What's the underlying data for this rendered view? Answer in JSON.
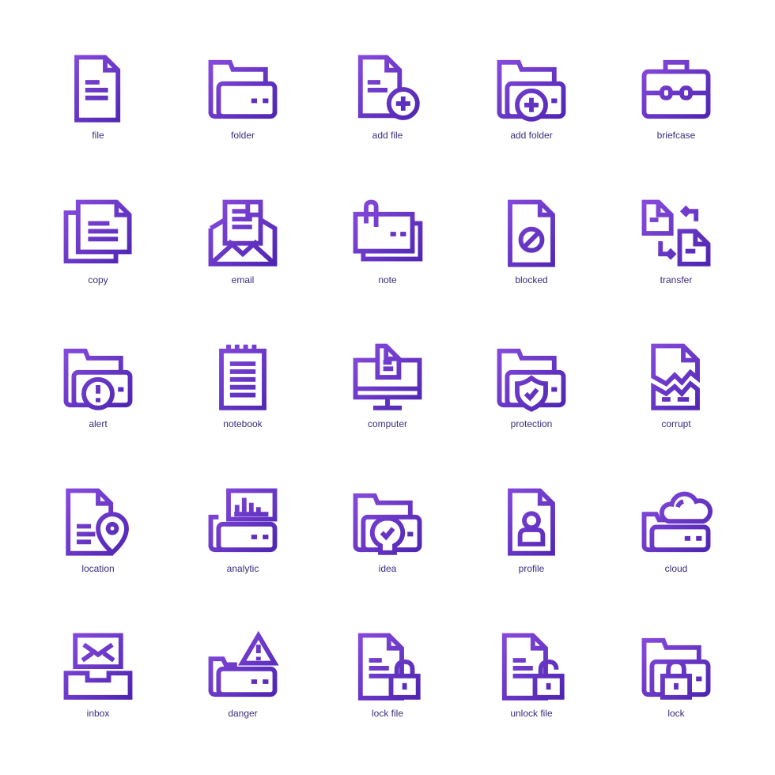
{
  "colors": {
    "gradient_start": "#8a4de0",
    "gradient_end": "#4a22ae",
    "label": "#3d2b7c",
    "background": "#ffffff"
  },
  "icons": [
    {
      "icon": "file",
      "label": "file"
    },
    {
      "icon": "folder",
      "label": "folder"
    },
    {
      "icon": "add-file",
      "label": "add file"
    },
    {
      "icon": "add-folder",
      "label": "add folder"
    },
    {
      "icon": "briefcase",
      "label": "briefcase"
    },
    {
      "icon": "copy",
      "label": "copy"
    },
    {
      "icon": "email",
      "label": "email"
    },
    {
      "icon": "note",
      "label": "note"
    },
    {
      "icon": "blocked",
      "label": "blocked"
    },
    {
      "icon": "transfer",
      "label": "transfer"
    },
    {
      "icon": "alert",
      "label": "alert"
    },
    {
      "icon": "notebook",
      "label": "notebook"
    },
    {
      "icon": "computer",
      "label": "computer"
    },
    {
      "icon": "protection",
      "label": "protection"
    },
    {
      "icon": "corrupt",
      "label": "corrupt"
    },
    {
      "icon": "location",
      "label": "location"
    },
    {
      "icon": "analytic",
      "label": "analytic"
    },
    {
      "icon": "idea",
      "label": "idea"
    },
    {
      "icon": "profile",
      "label": "profile"
    },
    {
      "icon": "cloud",
      "label": "cloud"
    },
    {
      "icon": "inbox",
      "label": "inbox"
    },
    {
      "icon": "danger",
      "label": "danger"
    },
    {
      "icon": "lock-file",
      "label": "lock file"
    },
    {
      "icon": "unlock-file",
      "label": "unlock file"
    },
    {
      "icon": "lock",
      "label": "lock"
    }
  ]
}
